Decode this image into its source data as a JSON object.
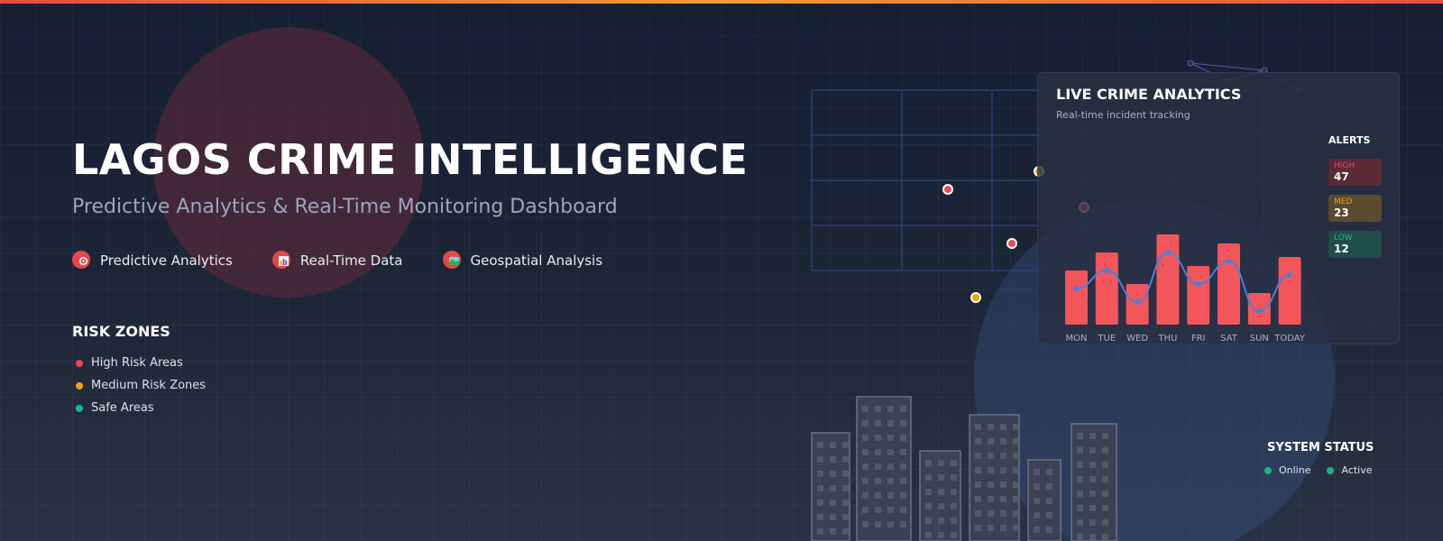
{
  "header": {
    "title": "LAGOS CRIME INTELLIGENCE",
    "subtitle": "Predictive Analytics & Real-Time Monitoring Dashboard"
  },
  "features": [
    {
      "label": "Predictive Analytics",
      "icon": "target-icon"
    },
    {
      "label": "Real-Time Data",
      "icon": "bar-chart-icon"
    },
    {
      "label": "Geospatial Analysis",
      "icon": "map-icon"
    }
  ],
  "risk_zones": {
    "title": "RISK ZONES",
    "items": [
      {
        "label": "High Risk Areas",
        "color": "#e84b52"
      },
      {
        "label": "Medium Risk Zones",
        "color": "#f2a217"
      },
      {
        "label": "Safe Areas",
        "color": "#19b58a"
      }
    ]
  },
  "analytics_card": {
    "title": "LIVE CRIME ANALYTICS",
    "subtitle": "Real-time incident tracking"
  },
  "chart_data": {
    "type": "bar",
    "categories": [
      "MON",
      "TUE",
      "WED",
      "THU",
      "FRI",
      "SAT",
      "SUN",
      "TODAY"
    ],
    "values": [
      60,
      80,
      45,
      100,
      65,
      90,
      35,
      75
    ],
    "trend_line": true,
    "ylim": [
      0,
      100
    ],
    "grid": false,
    "bar_color": "#f2565a",
    "line_color": "#4a7fe0"
  },
  "alerts": {
    "title": "ALERTS",
    "items": [
      {
        "label": "HIGH",
        "value": "47",
        "color": "#e84b52",
        "bg": "#5a2a36"
      },
      {
        "label": "MED",
        "value": "23",
        "color": "#f2a217",
        "bg": "#5a4a2e"
      },
      {
        "label": "LOW",
        "value": "12",
        "color": "#19b58a",
        "bg": "#1f4d4a"
      }
    ]
  },
  "system_status": {
    "title": "SYSTEM STATUS",
    "items": [
      {
        "label": "Online",
        "color": "#19b58a"
      },
      {
        "label": "Active",
        "color": "#19b58a"
      }
    ]
  },
  "colors": {
    "accent_red": "#e84b52",
    "accent_orange": "#f2a217",
    "accent_green": "#19b58a",
    "map_line": "#2e4a86"
  }
}
